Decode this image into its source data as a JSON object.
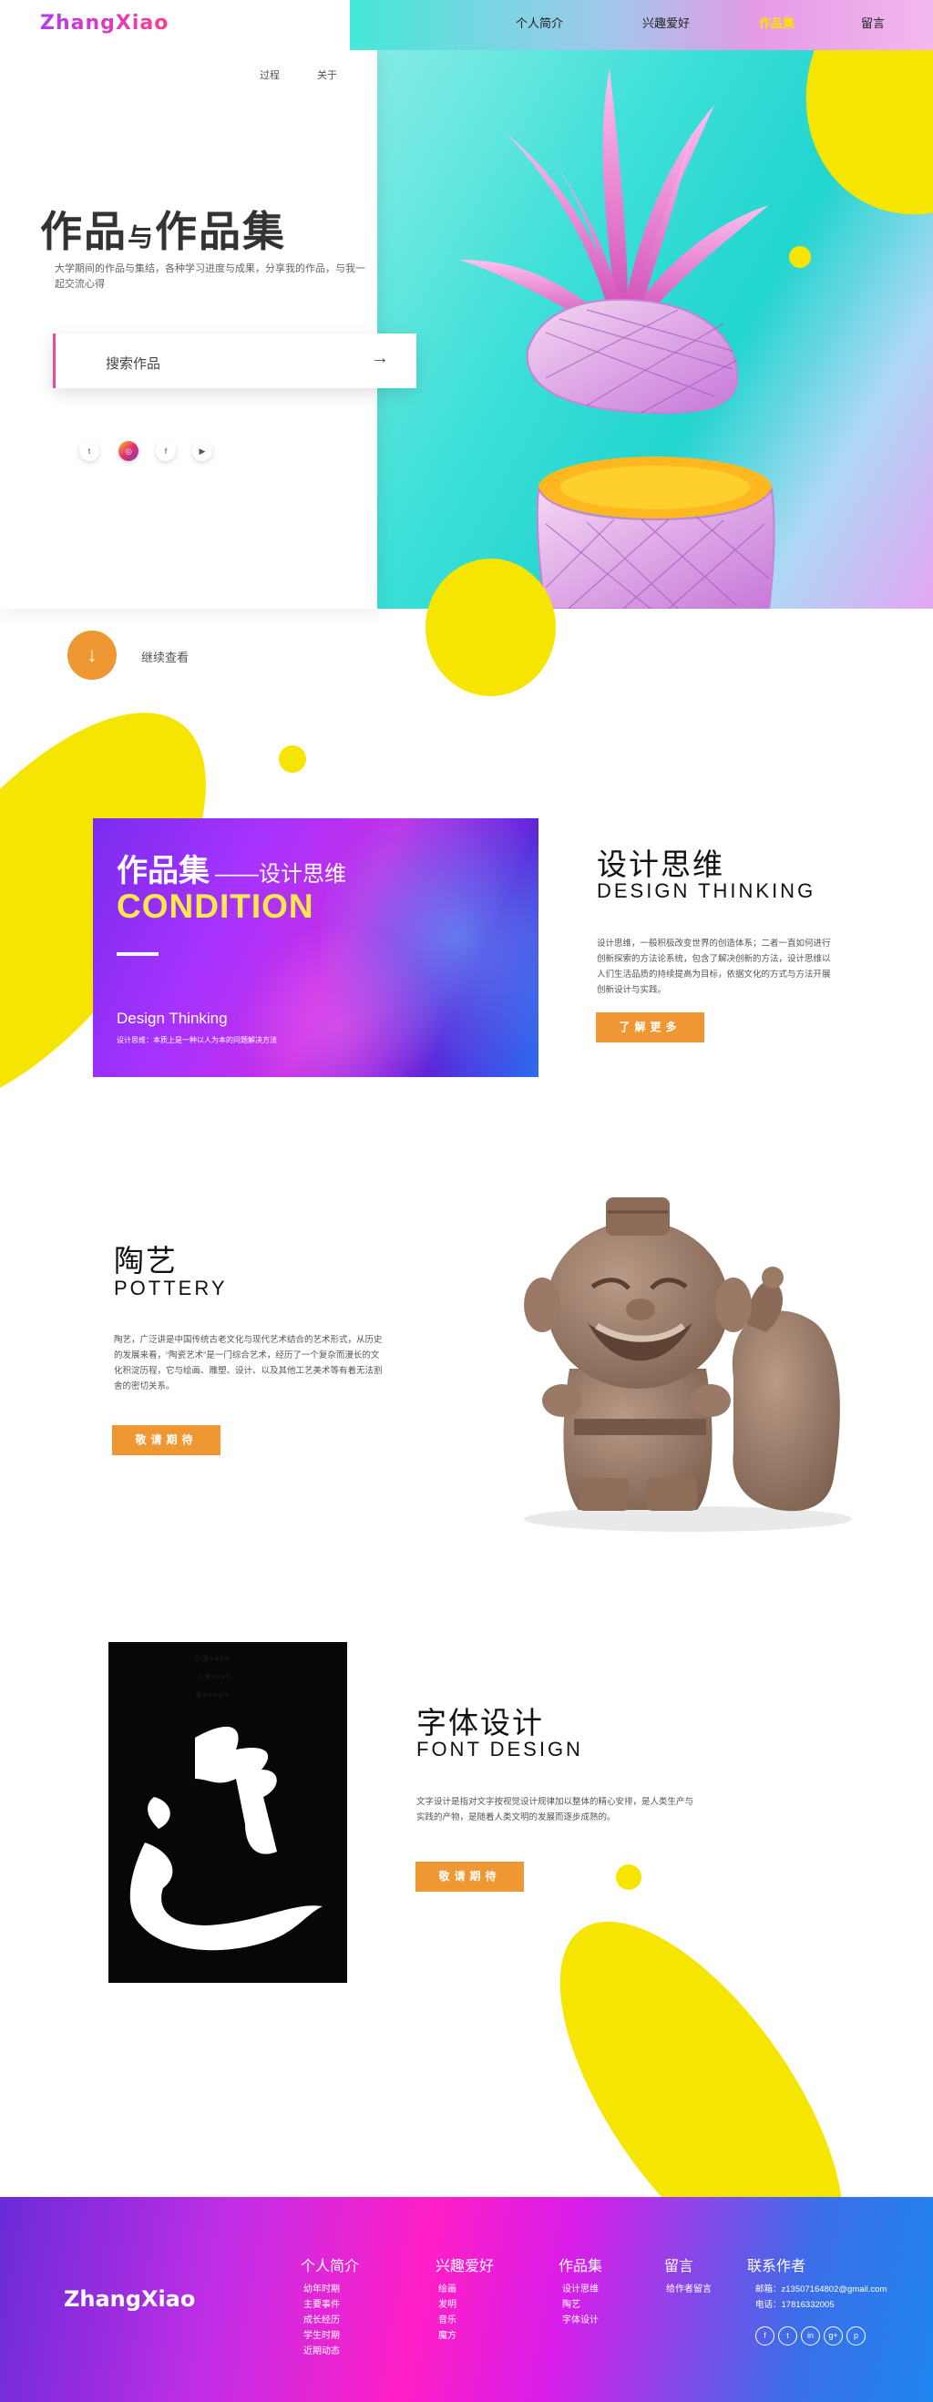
{
  "header": {
    "logo": "ZhangXiao",
    "nav": [
      "个人简介",
      "兴趣爱好",
      "作品集",
      "留言"
    ],
    "active_index": 2,
    "subnav": [
      "过程",
      "关于"
    ]
  },
  "hero": {
    "title_a": "作品",
    "title_small": "与",
    "title_b": "作品集",
    "desc": "大学期间的作品与集结，各种学习进度与成果，分享我的作品，与我一起交流心得",
    "search_label": "搜索作品",
    "search_arrow": "→",
    "social_icons": [
      "twitter-icon",
      "instagram-icon",
      "facebook-icon",
      "youtube-icon"
    ],
    "scroll_label": "继续查看"
  },
  "design_section": {
    "card_title": "作品集",
    "card_dash": "——设计思维",
    "card_condition": "CONDITION",
    "card_en": "Design Thinking",
    "card_small": "设计思维：本质上是一种以人为本的问题解决方法",
    "title": "设计思维",
    "subtitle": "DESIGN THINKING",
    "desc": "设计思维，一般积极改变世界的创造体系；二者一直如何进行创新探索的方法论系统，包含了解决创新的方法，设计思维以人们生活品质的持续提高为目标，依据文化的方式与方法开展创新设计与实践。",
    "button": "了解更多"
  },
  "pottery_section": {
    "title": "陶艺",
    "subtitle": "POTTERY",
    "desc": "陶艺，广泛讲是中国传统古老文化与现代艺术结合的艺术形式，从历史的发展来看，“陶瓷艺术”是一门综合艺术，经历了一个复杂而漫长的文化积淀历程，它与绘画、雕塑、设计、以及其他工艺美术等有着无法割舍的密切关系。",
    "button": "敬请期待"
  },
  "font_section": {
    "title": "字体设计",
    "subtitle": "FONT DESIGN",
    "desc": "文字设计是指对文字按视觉设计规律加以整体的精心安排，是人类生产与实践的产物，是随着人类文明的发展而逐步成熟的。",
    "button": "敬请期待",
    "poster_char": "道"
  },
  "footer": {
    "logo": "ZhangXiao",
    "columns": [
      {
        "head": "个人简介",
        "items": [
          "幼年时期",
          "主要事件",
          "成长经历",
          "学生时期",
          "近期动态"
        ]
      },
      {
        "head": "兴趣爱好",
        "items": [
          "绘画",
          "发明",
          "音乐",
          "魔方"
        ]
      },
      {
        "head": "作品集",
        "items": [
          "设计思维",
          "陶艺",
          "字体设计"
        ]
      },
      {
        "head": "留言",
        "items": [
          "给作者留言"
        ]
      },
      {
        "head": "联系作者",
        "items": [
          "邮箱：z13507164802@gmail.com",
          "电话：17816332005"
        ]
      }
    ],
    "social_glyphs": [
      "f",
      "t",
      "in",
      "g+",
      "p"
    ]
  }
}
